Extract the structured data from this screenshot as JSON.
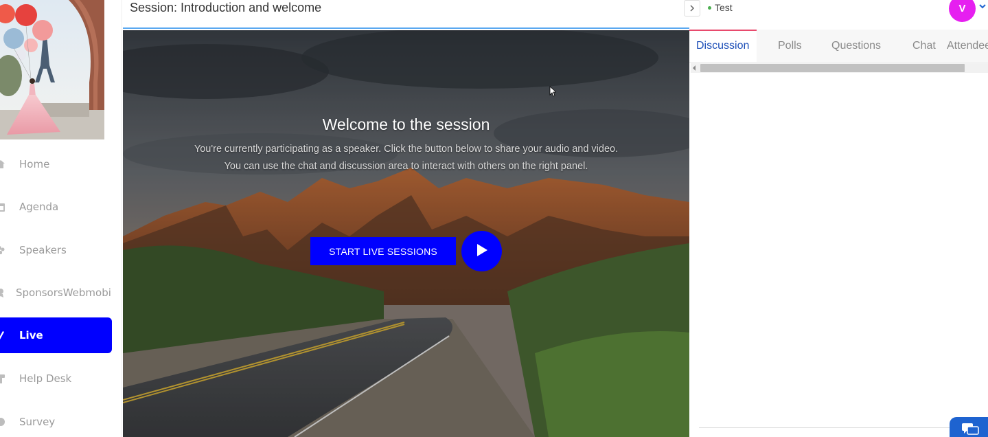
{
  "session": {
    "title": "Session: Introduction and welcome"
  },
  "sidebar": {
    "items": [
      {
        "label": "Home",
        "icon": "home-icon"
      },
      {
        "label": "Agenda",
        "icon": "calendar-icon"
      },
      {
        "label": "Speakers",
        "icon": "speakers-icon"
      },
      {
        "label": "SponsorsWebmobi",
        "icon": "sponsors-icon"
      },
      {
        "label": "Live",
        "icon": "live-icon",
        "active": true
      },
      {
        "label": "Help Desk",
        "icon": "help-desk-icon"
      },
      {
        "label": "Survey",
        "icon": "survey-icon"
      }
    ]
  },
  "stage": {
    "welcome_title": "Welcome to the session",
    "welcome_line_1": "You're currently participating as a speaker. Click the button below to share your audio and video.",
    "welcome_line_2": "You can use the chat and discussion area to interact with others on the right panel.",
    "start_button_label": "START LIVE SESSIONS"
  },
  "right_panel": {
    "room_status": "Test",
    "user_initial": "V",
    "tabs": [
      {
        "label": "Discussion",
        "active": true
      },
      {
        "label": "Polls"
      },
      {
        "label": "Questions"
      },
      {
        "label": "Chat"
      },
      {
        "label": "Attendees"
      }
    ]
  },
  "colors": {
    "accent_blue": "#0000ff",
    "avatar_magenta": "#e61ff0",
    "active_tab_text": "#1d4fb8",
    "active_tab_border": "#e84a6d",
    "status_dot": "#4caf50",
    "chat_widget": "#1e63d0"
  }
}
